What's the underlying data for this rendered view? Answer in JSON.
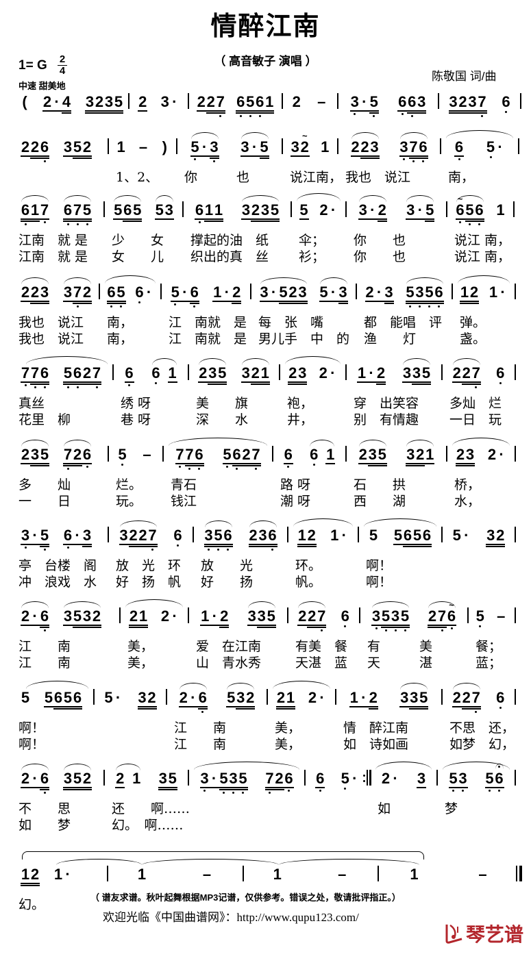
{
  "title": "情醉江南",
  "subtitle": "（ 高音敏子 演唱 ）",
  "key": "1= G",
  "time_signature": {
    "numerator": "2",
    "denominator": "4"
  },
  "tempo": "中速 甜美地",
  "credits": "陈敬国 词/曲",
  "systems": [
    {
      "measures": [
        {
          "g": [
            "(0",
            "21 ·1 42",
            "32 22 32 52"
          ]
        },
        {
          "g": [
            "21",
            "30 ·0"
          ]
        },
        {
          "g": [
            "21 22 72,",
            "62, 52, 62, 12"
          ]
        },
        {
          "g": [
            "20",
            "-0"
          ]
        },
        {
          "g": [
            "31, ·1 52,",
            "61, 62, 32"
          ]
        },
        {
          "g": [
            "32 22 32 72,",
            "60,"
          ]
        }
      ],
      "lyrics": []
    },
    {
      "measures": [
        {
          "g": [
            "21 22 62,",
            "31 52 22"
          ]
        },
        {
          "g": [
            "10",
            "-0",
            ")0"
          ]
        },
        {
          "g": [
            "^51, ·1 32,",
            "^31 ·1 52"
          ]
        },
        {
          "g": [
            "31 21~",
            "10"
          ]
        },
        {
          "g": [
            "^21 22 32",
            "^31, 72, 62,"
          ]
        },
        {
          "g": [
            "61,",
            "50, ·0"
          ],
          "slur": true
        }
      ],
      "lyrics": [
        [
          "",
          "1、2、",
          "你　　　也",
          "说江南，",
          "我也　说江",
          "南，"
        ]
      ]
    },
    {
      "measures": [
        {
          "g": [
            "^62, 12 71,",
            "^62, 72, 52,"
          ]
        },
        {
          "g": [
            "^51 62 52",
            "^51 31"
          ]
        },
        {
          "g": [
            "61, 12 12",
            "^31 22 32 52"
          ]
        },
        {
          "g": [
            "51",
            "20 ·0"
          ],
          "slur": true
        },
        {
          "g": [
            "^31 ·1 22",
            "^31 ·1 52"
          ]
        },
        {
          "g": [
            "^61,~ 52, 62,",
            "10"
          ]
        }
      ],
      "lyrics": [
        [
          "江南　就 是",
          "少　　女",
          "撑起的油　纸",
          "伞；",
          "你　　也",
          "说江 南，"
        ],
        [
          "江南　就 是",
          "女　　儿",
          "织出的真　丝",
          "衫；",
          "你　　也",
          "说江 南，"
        ]
      ]
    },
    {
      "measures": [
        {
          "g": [
            "^21 22 32",
            "^31 72, 22"
          ]
        },
        {
          "g": [
            "62, 52,",
            "60, ·0"
          ],
          "slur": true
        },
        {
          "g": [
            "51, ·1 62,",
            "11 ·1 22"
          ]
        },
        {
          "g": [
            "^31 ·1 52 22 32",
            "^51 ·1 32"
          ]
        },
        {
          "g": [
            "21 ·1 32",
            "^52, 32, 52, 62,"
          ]
        },
        {
          "g": [
            "12 22",
            "10 ·0"
          ],
          "slur": true
        }
      ],
      "lyrics": [
        [
          "我也　说江",
          "南，",
          "江　南就　是",
          "每　张　嘴",
          "都　能唱　评",
          "弹。"
        ],
        [
          "我也　说江",
          "南，",
          "江　南就　是",
          "男儿手　中　的",
          "渔　　灯",
          "盏。"
        ]
      ]
    },
    {
      "measures": [
        {
          "g": [
            "71, 72, 62,",
            "52, 62, 22 72,"
          ],
          "slur": true
        },
        {
          "g": [
            "61,",
            "^60, _0 11"
          ]
        },
        {
          "g": [
            "^21 32 52",
            "^31 22 12"
          ]
        },
        {
          "g": [
            "22 32",
            "20 ·0"
          ],
          "slur": true
        },
        {
          "g": [
            "11 ·1 22",
            "^31 32 52"
          ]
        },
        {
          "g": [
            "^21 22 72,",
            "60,"
          ]
        }
      ],
      "lyrics": [
        [
          "真丝",
          "绣 呀",
          "美　　旗",
          "袍，",
          "穿　出笑容",
          "多灿　烂"
        ],
        [
          "花里　柳",
          "巷 呀",
          "深　　水",
          "井，",
          "别　有情趣",
          "一日　玩"
        ]
      ]
    },
    {
      "measures": [
        {
          "g": [
            "^21 32 52",
            "^72, 22 61,"
          ]
        },
        {
          "g": [
            "50,",
            "-0"
          ]
        },
        {
          "g": [
            "71, 72, 62,",
            "51, 62, 22 72,"
          ],
          "slur": true
        },
        {
          "g": [
            "61,",
            "^60, _0 11"
          ]
        },
        {
          "g": [
            "^21 32 52",
            "^32 22 11"
          ]
        },
        {
          "g": [
            "22 32",
            "20 ·0"
          ],
          "slur": true
        }
      ],
      "lyrics": [
        [
          "多　　灿",
          "烂。",
          "青石",
          "路 呀",
          "石　　拱",
          "桥，"
        ],
        [
          "一　　日",
          "玩。",
          "钱江",
          "潮 呀",
          "西　　湖",
          "水，"
        ]
      ]
    },
    {
      "measures": [
        {
          "g": [
            "31, ·1 52,",
            "61, ·1 32"
          ]
        },
        {
          "g": [
            "^31 22 22 72,",
            "60,"
          ]
        },
        {
          "g": [
            "^32, 52, 62,",
            "^22 32 62,"
          ]
        },
        {
          "g": [
            "12 22",
            "10 ·0"
          ],
          "slur": true
        },
        {
          "g": [
            "50",
            "51 62 52 62"
          ],
          "slur": true
        },
        {
          "g": [
            "50 ·0",
            "32 22"
          ]
        }
      ],
      "lyrics": [
        [
          "亭　台楼　阁",
          "放　光　环",
          "放　　光",
          "环。",
          "啊！",
          ""
        ],
        [
          "冲　浪戏　水",
          "好　扬　帆",
          "好　　扬",
          "帆。",
          "啊！",
          ""
        ]
      ]
    },
    {
      "measures": [
        {
          "g": [
            "^21 ·1 62,",
            "^31 52 32 22"
          ]
        },
        {
          "g": [
            "22 12",
            "20 ·0"
          ],
          "slur": true
        },
        {
          "g": [
            "11 ·1 22",
            "^31 32 52"
          ]
        },
        {
          "g": [
            "^21 22 72,",
            "60,"
          ]
        },
        {
          "g": [
            "^31, 52, 32, 52,",
            "^22 72, 61,~"
          ]
        },
        {
          "g": [
            "50,",
            "-0"
          ]
        }
      ],
      "lyrics": [
        [
          "江　　南",
          "美，",
          "爱　在江南",
          "有美　餐",
          "有　　　美",
          "餐；"
        ],
        [
          "江　　南",
          "美，",
          "山　青水秀",
          "天湛　蓝",
          "天　　　湛",
          "蓝；"
        ]
      ]
    },
    {
      "measures": [
        {
          "g": [
            "50",
            "51 62 52 62"
          ],
          "slur": true
        },
        {
          "g": [
            "50 ·0",
            "32 22"
          ]
        },
        {
          "g": [
            "^21 ·1 62,",
            "^51 32 22"
          ]
        },
        {
          "g": [
            "22 12",
            "20 ·0"
          ],
          "slur": true
        },
        {
          "g": [
            "11 ·1 22",
            "^31 32 52"
          ]
        },
        {
          "g": [
            "^21 22 72,",
            "60,"
          ]
        }
      ],
      "lyrics": [
        [
          "啊！",
          "",
          "江　　南",
          "美，",
          "情　醉江南",
          "不思　还，"
        ],
        [
          "啊！",
          "",
          "江　　南",
          "美，",
          "如　诗如画",
          "如梦　幻，"
        ]
      ]
    },
    {
      "measures": [
        {
          "g": [
            "^21 ·1 62,",
            "^32 52 22"
          ]
        },
        {
          "g": [
            "^21 _0 10",
            "32 52"
          ]
        },
        {
          "g": [
            "31, ·1 52, 32, 52,",
            "72, 22 61,"
          ],
          "slur": true
        },
        {
          "g": [
            "61,",
            "50, ·0"
          ],
          "bar": ":|"
        },
        {
          "g": [
            "20 ·0",
            "31"
          ],
          "slur": true
        },
        {
          "g": [
            "51, 31,",
            "51, 61,f"
          ],
          "slur": true
        }
      ],
      "lyrics": [
        [
          "不　　思",
          "还　　啊……",
          "",
          "",
          "如",
          "梦"
        ],
        [
          "如　　梦",
          "幻。　啊……",
          "",
          "",
          "",
          ""
        ]
      ]
    },
    {
      "measures": [
        {
          "g": [
            "12 22",
            "10 ·0"
          ]
        },
        {
          "g": [
            "10",
            "-0"
          ]
        },
        {
          "g": [
            "10",
            "-0"
          ]
        },
        {
          "g": [
            "10",
            "-0"
          ],
          "bar": "||"
        }
      ],
      "volta": true,
      "tie": true,
      "lyrics": [
        [
          "幻。",
          "",
          "",
          ""
        ]
      ]
    }
  ],
  "footer": {
    "note": "（ 谱友求谱。秋叶起舞根据MP3记谱，仅供参考。错误之处，敬请批评指正。）",
    "website": "欢迎光临《中国曲谱网》：http://www.qupu123.com/"
  },
  "logo": {
    "text": "琴艺谱",
    "color": "#b3262c"
  }
}
